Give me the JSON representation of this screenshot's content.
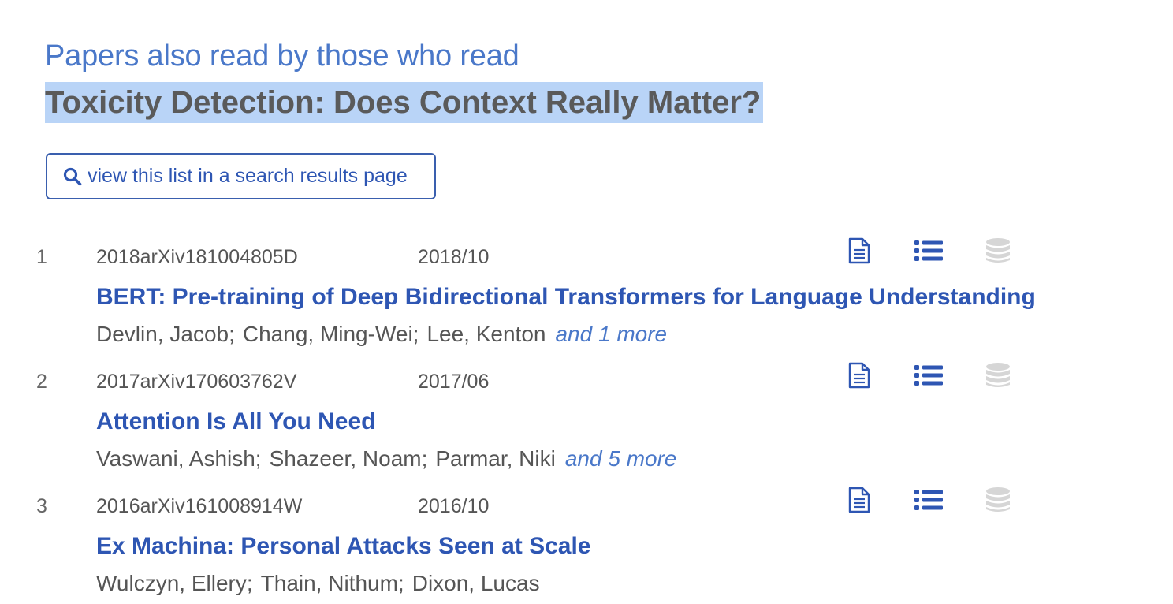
{
  "header": {
    "pre": "Papers also read by those who read",
    "title": "Toxicity Detection: Does Context Really Matter?"
  },
  "search_button": {
    "label": "view this list in a search results page",
    "icon": "search-icon"
  },
  "colors": {
    "link": "#2e56b3",
    "heading_blue": "#4a78c9",
    "selection": "#b9d4f7",
    "disabled_icon": "#d6d6d6"
  },
  "papers": [
    {
      "num": "1",
      "bibcode": "2018arXiv181004805D",
      "date": "2018/10",
      "title": "BERT: Pre-training of Deep Bidirectional Transformers for Language Understanding",
      "authors": [
        "Devlin, Jacob;",
        "Chang, Ming-Wei;",
        "Lee, Kenton"
      ],
      "more": "and 1 more"
    },
    {
      "num": "2",
      "bibcode": "2017arXiv170603762V",
      "date": "2017/06",
      "title": "Attention Is All You Need",
      "authors": [
        "Vaswani, Ashish;",
        "Shazeer, Noam;",
        "Parmar, Niki"
      ],
      "more": "and 5 more"
    },
    {
      "num": "3",
      "bibcode": "2016arXiv161008914W",
      "date": "2016/10",
      "title": "Ex Machina: Personal Attacks Seen at Scale",
      "authors": [
        "Wulczyn, Ellery;",
        "Thain, Nithum;",
        "Dixon, Lucas"
      ],
      "more": ""
    }
  ],
  "row_icons": [
    "abstract-document-icon",
    "references-list-icon",
    "data-database-icon"
  ]
}
